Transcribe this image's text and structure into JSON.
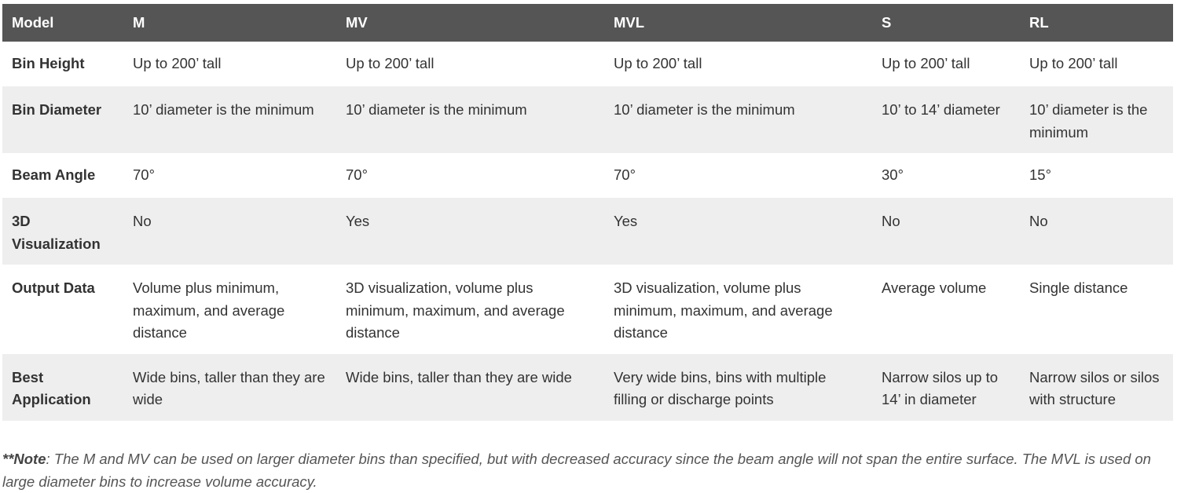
{
  "table": {
    "headers": [
      "Model",
      "M",
      "MV",
      "MVL",
      "S",
      "RL"
    ],
    "rows": [
      {
        "label": "Bin Height",
        "cells": [
          "Up to 200’ tall",
          "Up to 200’ tall",
          "Up to 200’ tall",
          "Up to 200’ tall",
          "Up to 200’ tall"
        ]
      },
      {
        "label": "Bin Diameter",
        "cells": [
          "10’ diameter is the minimum",
          "10’ diameter is the minimum",
          "10’ diameter is the minimum",
          "10’ to 14’ diameter",
          "10’ diameter is the minimum"
        ]
      },
      {
        "label": "Beam Angle",
        "cells": [
          "70°",
          "70°",
          "70°",
          "30°",
          "15°"
        ]
      },
      {
        "label": "3D Visualization",
        "cells": [
          "No",
          "Yes",
          "Yes",
          "No",
          "No"
        ]
      },
      {
        "label": "Output Data",
        "cells": [
          "Volume plus minimum, maximum, and average distance",
          "3D visualization, volume plus minimum, maximum, and average distance",
          "3D visualization, volume plus minimum, maximum, and average distance",
          "Average volume",
          "Single distance"
        ]
      },
      {
        "label": "Best Application",
        "cells": [
          "Wide bins, taller than they are wide",
          "Wide bins, taller than they are wide",
          "Very wide bins, bins with multiple filling or discharge points",
          "Narrow silos up to 14’ in diameter",
          "Narrow silos or silos with structure"
        ]
      }
    ]
  },
  "note": {
    "prefix": "**Note",
    "text": ": The M and MV can be used on larger diameter bins than specified, but with decreased accuracy since the beam angle will not span the entire surface. The MVL is used on large diameter bins to increase volume accuracy."
  }
}
